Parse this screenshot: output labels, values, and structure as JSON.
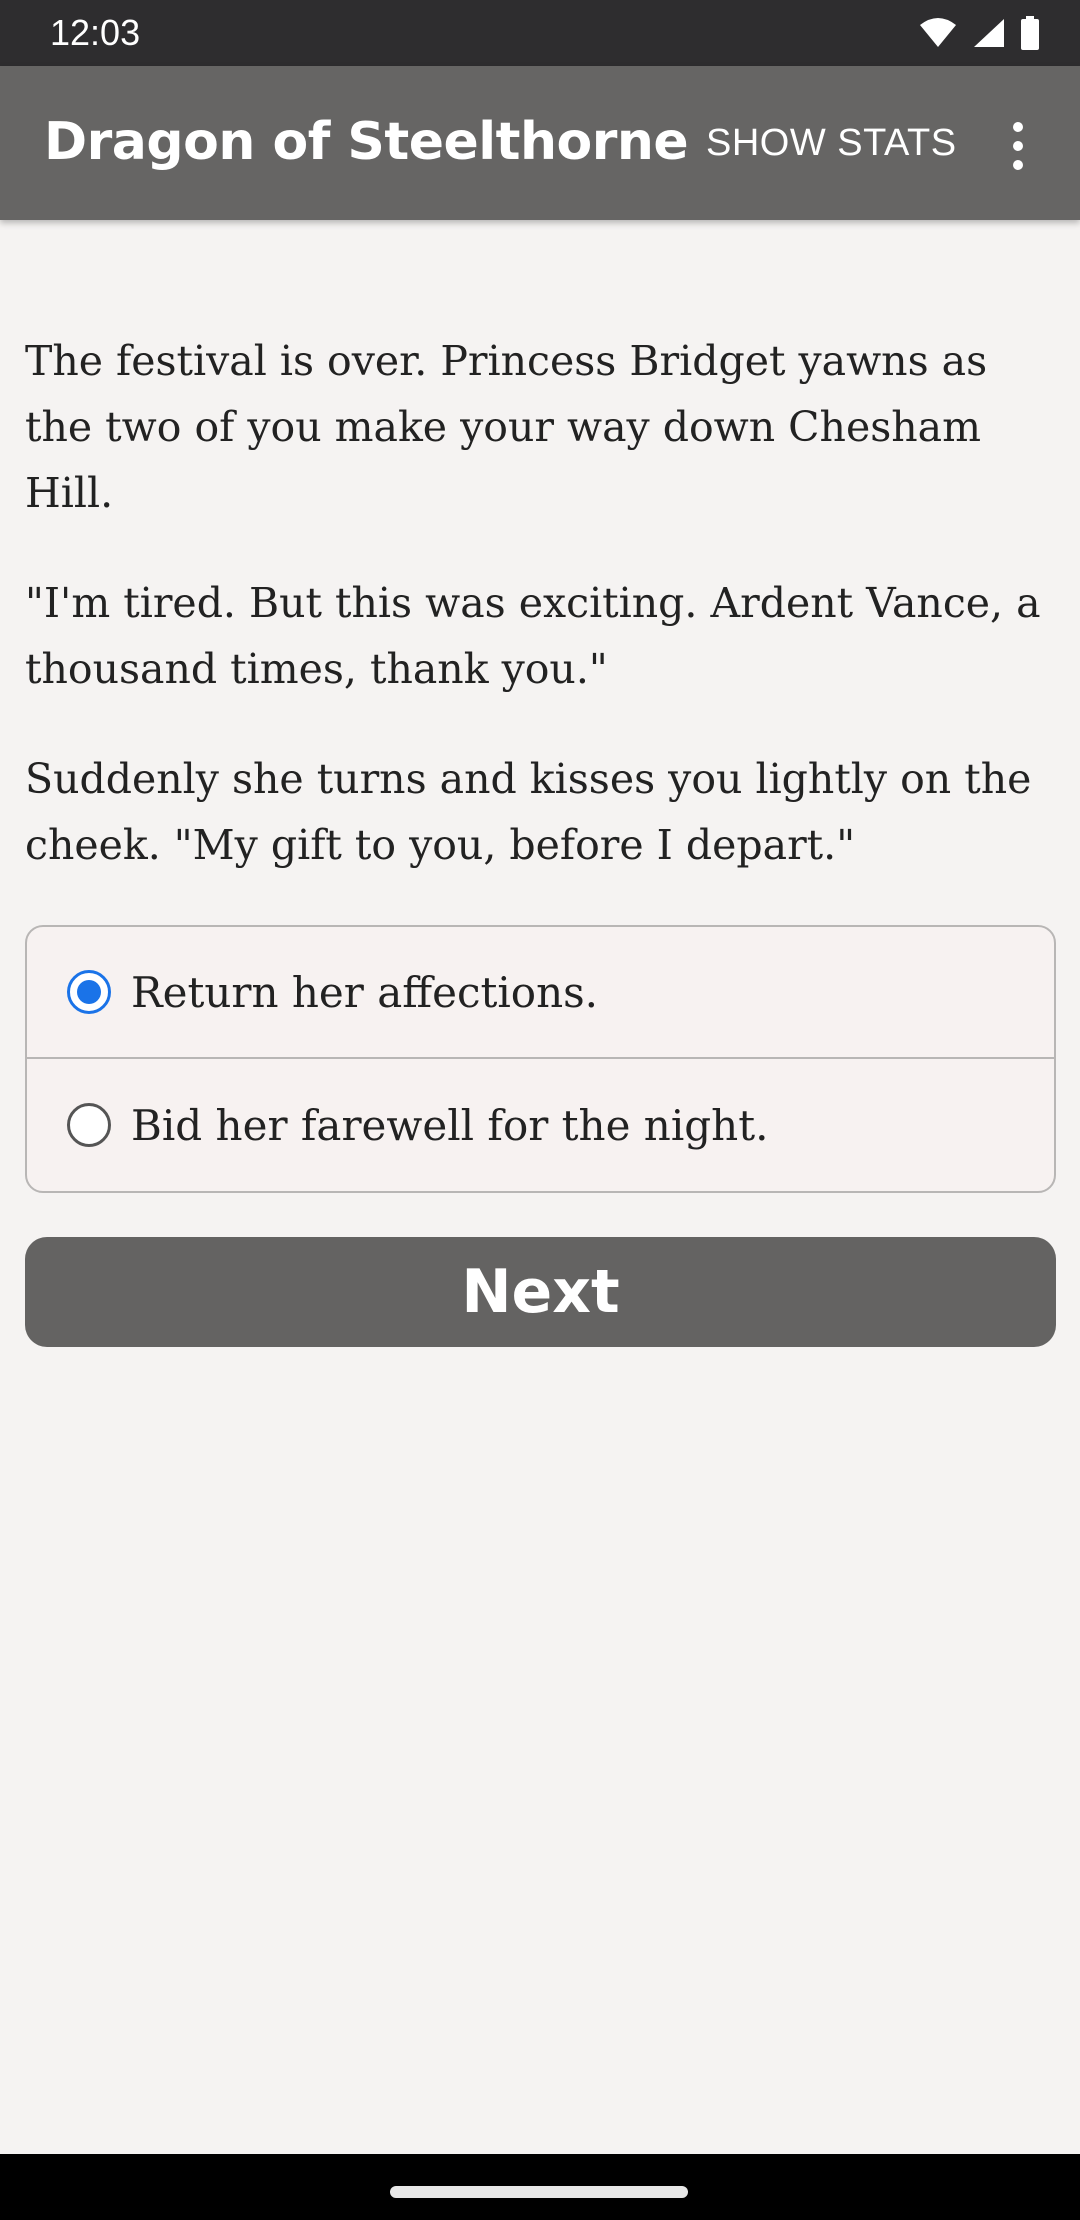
{
  "status_bar": {
    "time": "12:03",
    "icons": [
      "wifi-icon",
      "signal-icon",
      "battery-icon"
    ]
  },
  "app_bar": {
    "title": "Dragon of Steelthorne",
    "action_label": "SHOW STATS",
    "overflow_icon": "more-vert-icon"
  },
  "story": {
    "paragraphs": [
      "The festival is over. Princess Bridget yawns as the two of you make your way down Chesham Hill.",
      "\"I'm tired. But this was exciting. Ardent Vance, a thousand times, thank you.\"",
      "Suddenly she turns and kisses you lightly on the cheek. \"My gift to you, before I depart.\""
    ]
  },
  "choices": {
    "options": [
      {
        "label": "Return her affections.",
        "selected": true
      },
      {
        "label": "Bid her farewell for the night.",
        "selected": false
      }
    ]
  },
  "next_button": {
    "label": "Next"
  },
  "colors": {
    "app_bar": "#666564",
    "status_bar": "#2e2d2f",
    "radio_accent": "#1a73e8",
    "button": "#646362",
    "background": "#f5f3f2"
  }
}
